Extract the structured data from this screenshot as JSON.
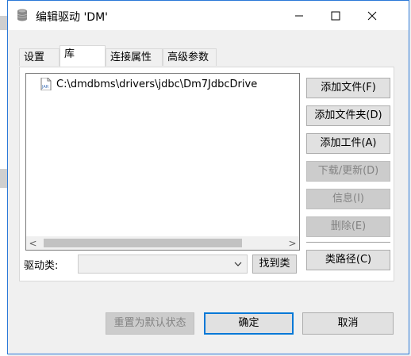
{
  "window": {
    "title": "编辑驱动 'DM'"
  },
  "tabs": [
    {
      "label": "设置"
    },
    {
      "label": "库"
    },
    {
      "label": "连接属性"
    },
    {
      "label": "高级参数"
    }
  ],
  "library": {
    "items": [
      {
        "path": "C:\\dmdbms\\drivers\\jdbc\\Dm7JdbcDrive",
        "icon": "jar-file-icon"
      }
    ],
    "scroll_left": "<",
    "scroll_right": ">"
  },
  "buttons": {
    "add_file": "添加文件(F)",
    "add_folder": "添加文件夹(D)",
    "add_artifact": "添加工件(A)",
    "download_update": "下载/更新(D)",
    "info": "信息(I)",
    "delete": "删除(E)",
    "class_path": "类路径(C)",
    "find_class": "找到类",
    "reset_default": "重置为默认状态",
    "ok": "确定",
    "cancel": "取消"
  },
  "driver_class": {
    "label": "驱动类:",
    "value": ""
  },
  "colors": {
    "window_border": "#2b79d8",
    "default_button_border": "#0078d7",
    "disabled_text": "#838383"
  }
}
